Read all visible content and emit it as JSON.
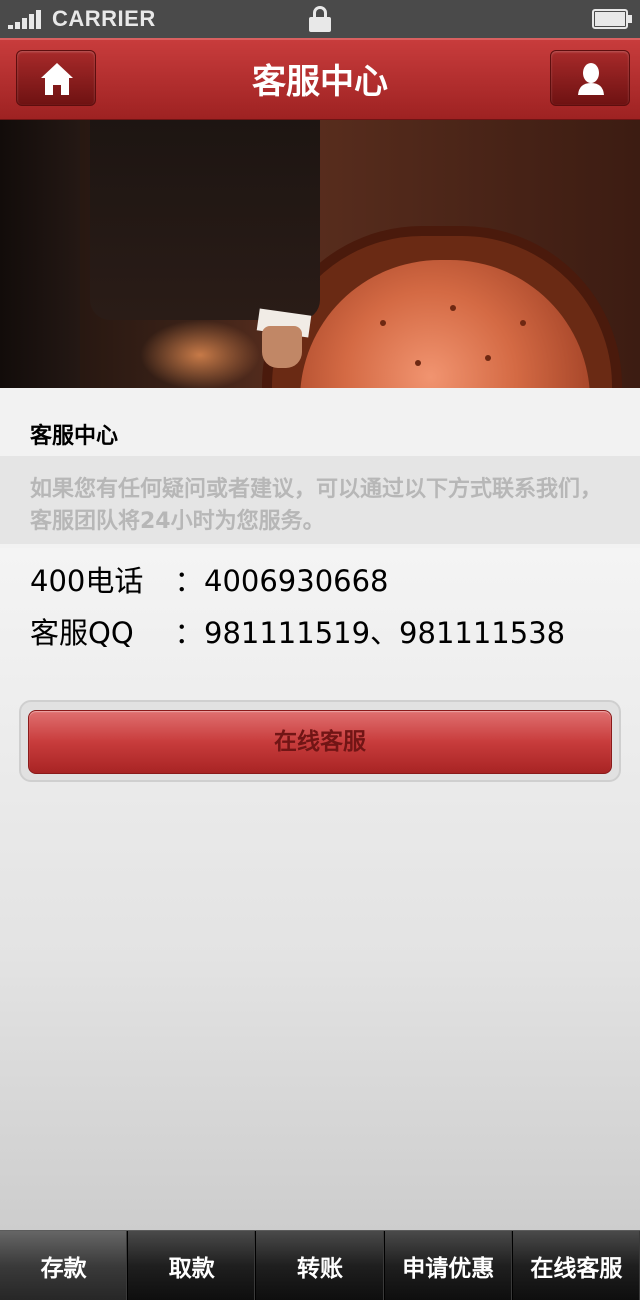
{
  "status_bar": {
    "carrier": "CARRIER"
  },
  "header": {
    "title": "客服中心",
    "left_button_icon": "home-icon",
    "right_button_icon": "user-icon"
  },
  "intro": {
    "title": "客服中心",
    "text": "如果您有任何疑问或者建议，可以通过以下方式联系我们，客服团队将24小时为您服务。"
  },
  "contacts": [
    {
      "label": "400电话",
      "separator": "：",
      "value": "4006930668"
    },
    {
      "label": "客服QQ",
      "separator": "：",
      "value": "981111519、981111538"
    }
  ],
  "online_button": {
    "label": "在线客服"
  },
  "tabs": [
    {
      "label": "存款"
    },
    {
      "label": "取款"
    },
    {
      "label": "转账"
    },
    {
      "label": "申请优惠"
    },
    {
      "label": "在线客服"
    }
  ],
  "colors": {
    "header_red": "#c83c3c",
    "title_white": "#FFFFFF",
    "intro_text": "#b7b7b7",
    "intro_band": "#e5e5e5",
    "button_text": "#711515",
    "tab_text": "#FFFFFF"
  }
}
